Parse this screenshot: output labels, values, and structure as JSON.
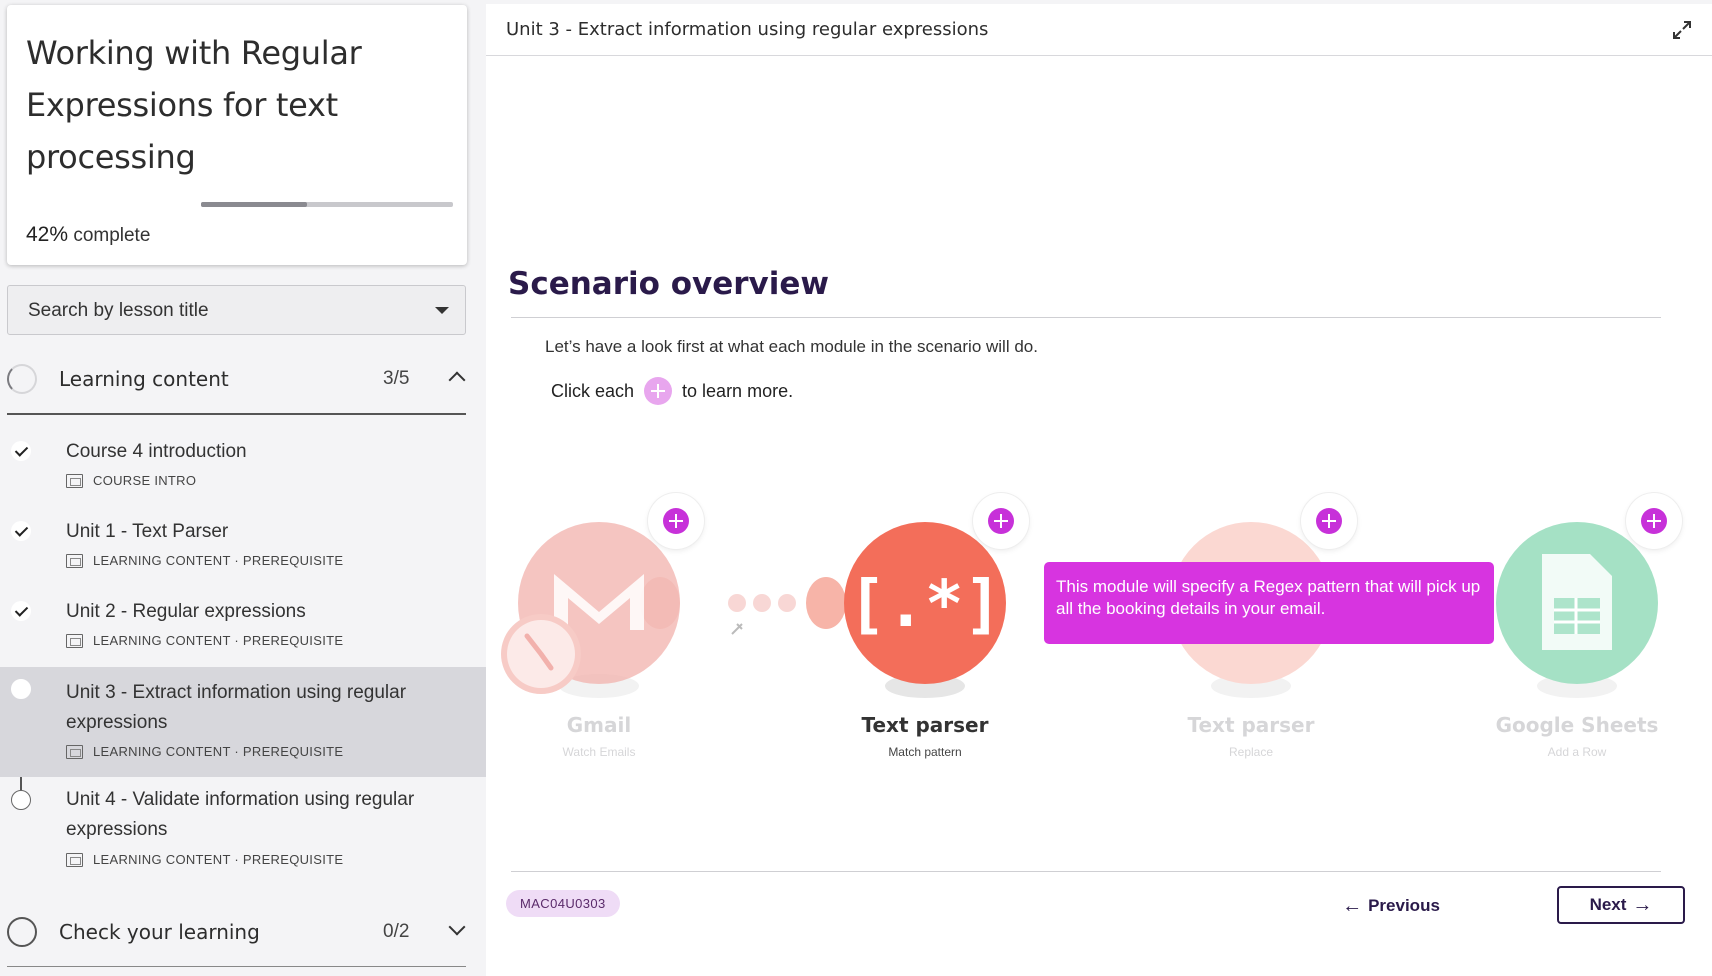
{
  "course": {
    "title": "Working with Regular Expressions for text processing",
    "progress_percent_label": "42%",
    "progress_suffix": "complete",
    "progress_fraction": 0.42
  },
  "search": {
    "placeholder": "Search by lesson title"
  },
  "sections": [
    {
      "title": "Learning content",
      "count": "3/5",
      "lessons": [
        {
          "title": "Course 4 introduction",
          "meta": "COURSE INTRO",
          "status": "done"
        },
        {
          "title": "Unit 1 - Text Parser",
          "meta": "LEARNING CONTENT · PREREQUISITE",
          "status": "done"
        },
        {
          "title": "Unit 2 - Regular expressions",
          "meta": "LEARNING CONTENT · PREREQUISITE",
          "status": "done"
        },
        {
          "title": "Unit 3 - Extract information using regular expressions",
          "meta": "LEARNING CONTENT · PREREQUISITE",
          "status": "current"
        },
        {
          "title": "Unit 4 - Validate information using regular expressions",
          "meta": "LEARNING CONTENT · PREREQUISITE",
          "status": "todo"
        }
      ]
    },
    {
      "title": "Check your learning",
      "count": "0/2"
    }
  ],
  "main": {
    "unit_title": "Unit 3 - Extract information using regular expressions",
    "scenario_heading": "Scenario overview",
    "intro_text": "Let’s have a look first at what each module in the scenario will do.",
    "click_prefix": "Click each",
    "click_suffix": "to learn more.",
    "modules": [
      {
        "name": "Gmail",
        "action": "Watch Emails",
        "color": "#f2b1ac"
      },
      {
        "name": "Text parser",
        "action": "Match pattern",
        "color": "#f36e5a"
      },
      {
        "name": "Text parser",
        "action": "Replace",
        "color": "#fbd8d2"
      },
      {
        "name": "Google Sheets",
        "action": "Add a Row",
        "color": "#a5e1c5"
      }
    ],
    "tooltip": "This module will specify a Regex pattern that will pick up all the booking details in your email.",
    "lesson_code": "MAC04U0303",
    "prev_label": "Previous",
    "next_label": "Next"
  },
  "colors": {
    "accent": "#c731d9",
    "tooltip_bg": "#d734e0",
    "dark_text": "#2a1a4a"
  }
}
